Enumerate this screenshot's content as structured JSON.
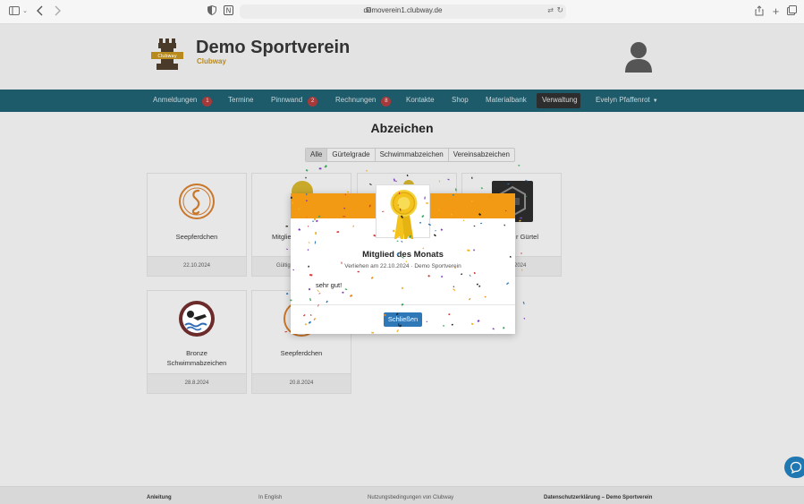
{
  "browser": {
    "url": "demoverein1.clubway.de"
  },
  "header": {
    "logo_text": "Clubway",
    "title": "Demo Sportverein",
    "subtitle": "Clubway"
  },
  "nav": {
    "items": [
      {
        "label": "Anmeldungen",
        "badge": "1"
      },
      {
        "label": "Termine",
        "badge": ""
      },
      {
        "label": "Pinnwand",
        "badge": "2"
      },
      {
        "label": "Rechnungen",
        "badge": "8"
      },
      {
        "label": "Kontakte",
        "badge": ""
      },
      {
        "label": "Shop",
        "badge": ""
      },
      {
        "label": "Materialbank",
        "badge": ""
      },
      {
        "label": "Verwaltung",
        "badge": ""
      },
      {
        "label": "Evelyn Pfaffenrot",
        "badge": ""
      }
    ]
  },
  "main": {
    "heading": "Abzeichen",
    "filters": [
      "Alle",
      "Gürtelgrade",
      "Schwimmabzeichen",
      "Vereinsabzeichen"
    ],
    "cards": [
      {
        "title": "Seepferdchen",
        "date": "22.10.2024"
      },
      {
        "title": "Mitglie",
        "date": "Gültig"
      },
      {
        "title": "",
        "date": ""
      },
      {
        "title": "r Gürtel",
        "date": "2024"
      },
      {
        "title": "Bronze Schwimmabzeichen",
        "date": "28.8.2024"
      },
      {
        "title": "Seepferdchen",
        "date": "20.8.2024"
      }
    ]
  },
  "modal": {
    "title": "Mitglied des Monats",
    "subtitle": "Verliehen am 22.10.2024 · Demo Sportverein",
    "text": "sehr gut!",
    "close_label": "Schließen"
  },
  "footer": {
    "links": [
      "Anleitung",
      "In English",
      "Nutzungsbedingungen von Clubway",
      "Datenschutzerklärung – Demo Sportverein"
    ]
  },
  "colors": {
    "nav_bg": "#1d5a6a",
    "badge": "#a63a3a",
    "modal_band": "#f29a14",
    "primary_button": "#2f78b8",
    "brand_gold": "#b88a1e"
  }
}
